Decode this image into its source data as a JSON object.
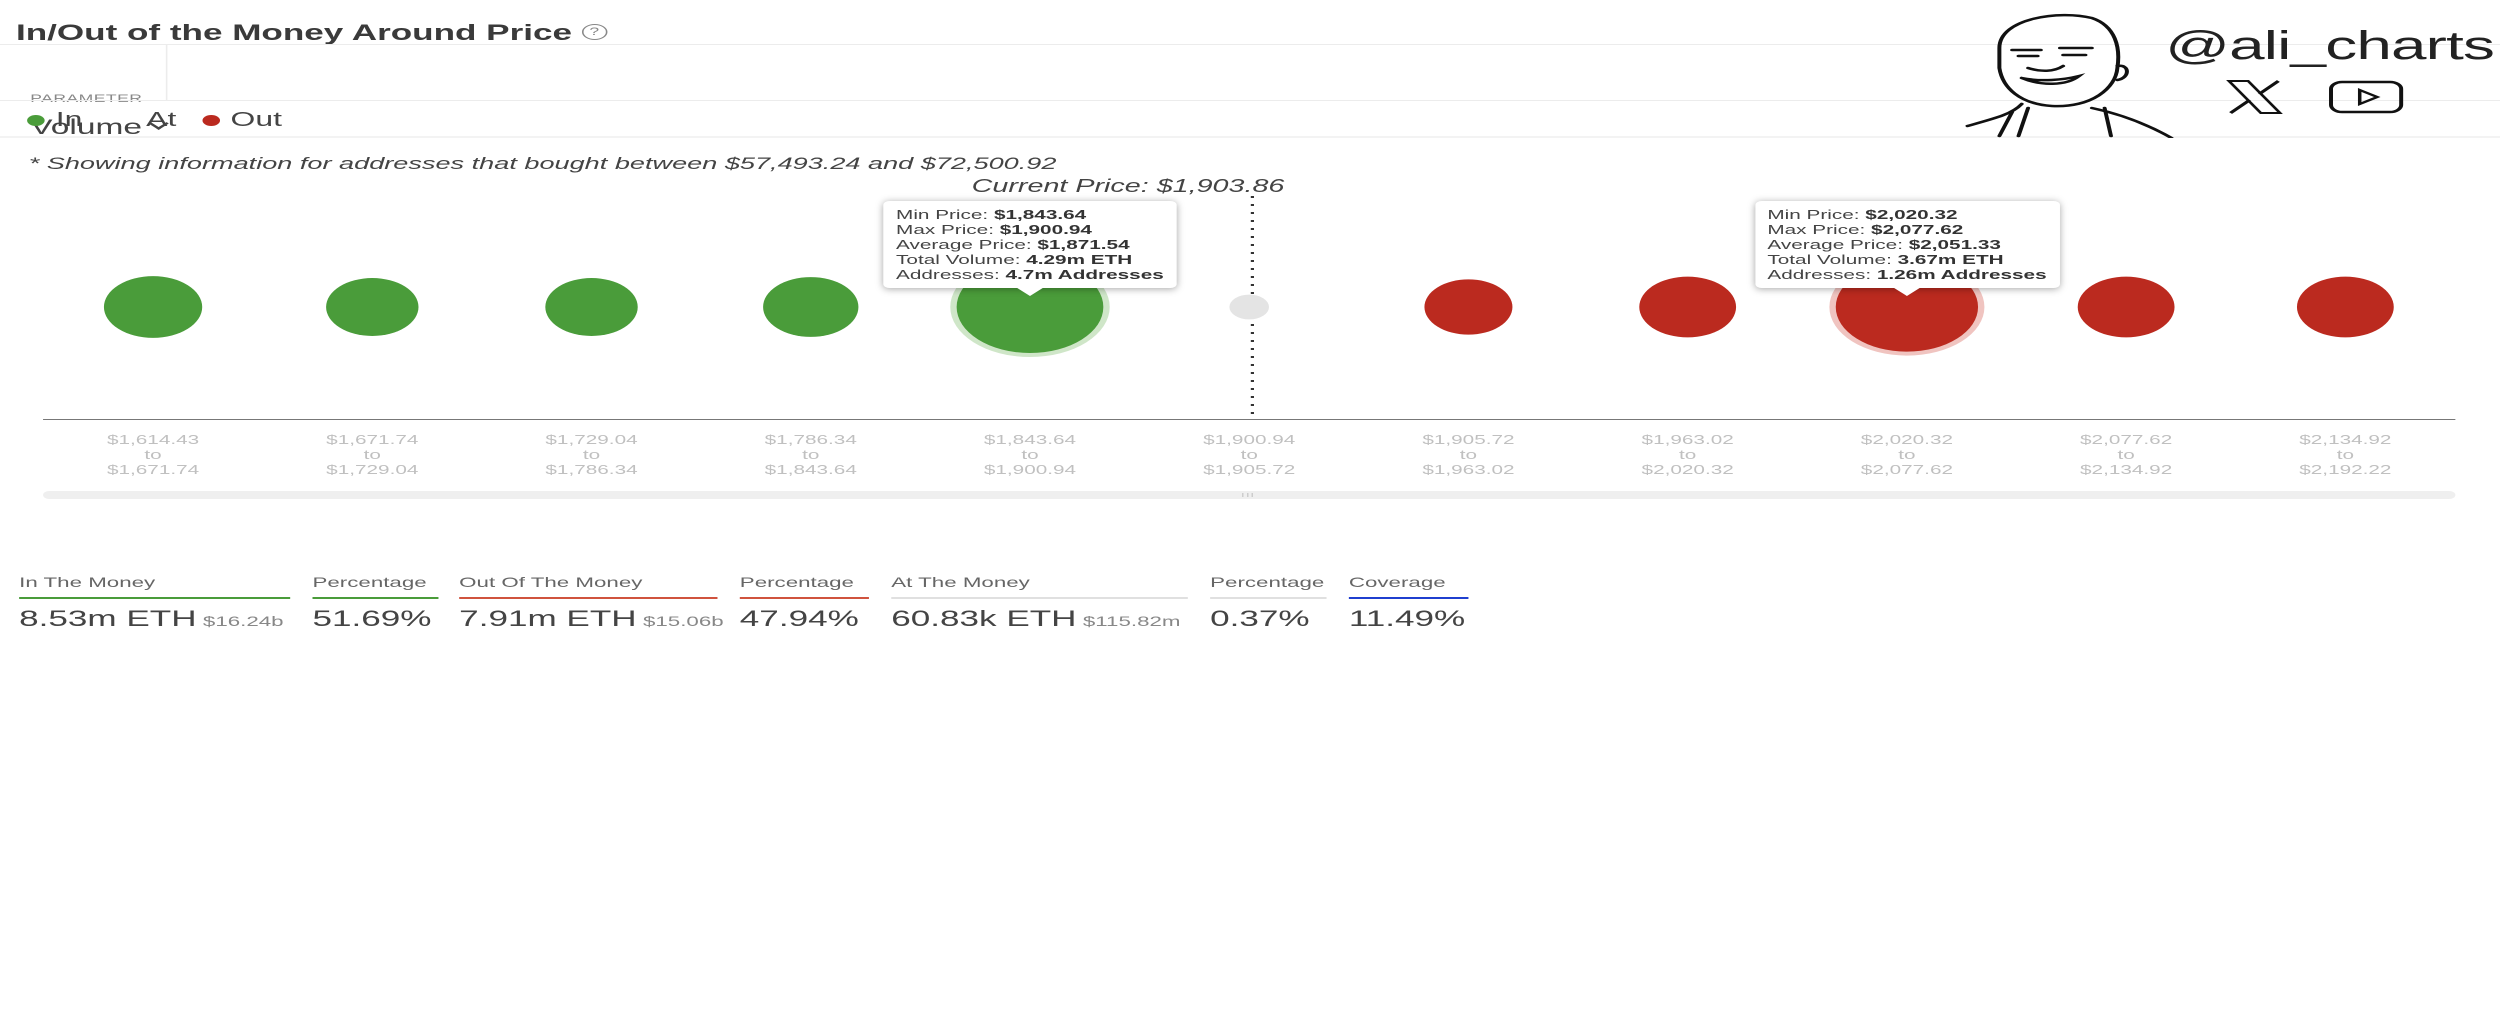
{
  "header": {
    "title": "In/Out of the Money Around Price",
    "help_icon": "?"
  },
  "parameter": {
    "label": "PARAMETER",
    "selected": "Volume"
  },
  "legend": [
    {
      "label": "In",
      "color": "#4a9c3a"
    },
    {
      "label": "At",
      "color": null
    },
    {
      "label": "Out",
      "color": "#bb2a1f"
    }
  ],
  "note": "* Showing information for addresses that bought between $57,493.24 and $72,500.92",
  "current_price_label": "Current Price: $1,903.86",
  "branding": {
    "handle": "@ali_charts",
    "icons": [
      "x-logo-icon",
      "youtube-icon",
      "meme-face-avatar"
    ]
  },
  "colors": {
    "in": "#4a9c3a",
    "out": "#bb2a1f",
    "at": "#e4e4e4",
    "coverage": "#1f3fcf"
  },
  "chart_data": {
    "type": "scatter",
    "title": "In/Out of the Money Around Price",
    "subtitle": "* Showing information for addresses that bought between $57,493.24 and $72,500.92",
    "xlabel": "",
    "ylabel": "",
    "current_price": 1903.86,
    "bubble_size_metric": "Volume",
    "legend": [
      "In",
      "At",
      "Out"
    ],
    "categories": [
      {
        "from": "$1,614.43",
        "to": "$1,671.74",
        "status": "In",
        "relative_size": 0.67
      },
      {
        "from": "$1,671.74",
        "to": "$1,729.04",
        "status": "In",
        "relative_size": 0.63
      },
      {
        "from": "$1,729.04",
        "to": "$1,786.34",
        "status": "In",
        "relative_size": 0.63
      },
      {
        "from": "$1,786.34",
        "to": "$1,843.64",
        "status": "In",
        "relative_size": 0.65
      },
      {
        "from": "$1,843.64",
        "to": "$1,900.94",
        "status": "In",
        "relative_size": 1.0,
        "highlighted": true
      },
      {
        "from": "$1,900.94",
        "to": "$1,905.72",
        "status": "At",
        "relative_size": 0.27
      },
      {
        "from": "$1,905.72",
        "to": "$1,963.02",
        "status": "Out",
        "relative_size": 0.6
      },
      {
        "from": "$1,963.02",
        "to": "$2,020.32",
        "status": "Out",
        "relative_size": 0.66
      },
      {
        "from": "$2,020.32",
        "to": "$2,077.62",
        "status": "Out",
        "relative_size": 0.97,
        "highlighted": true
      },
      {
        "from": "$2,077.62",
        "to": "$2,134.92",
        "status": "Out",
        "relative_size": 0.66
      },
      {
        "from": "$2,134.92",
        "to": "$2,192.22",
        "status": "Out",
        "relative_size": 0.66
      }
    ],
    "range_word": "to",
    "tooltips": [
      {
        "bin_index": 4,
        "rows": [
          {
            "k": "Min Price: ",
            "v": "$1,843.64"
          },
          {
            "k": "Max Price: ",
            "v": "$1,900.94"
          },
          {
            "k": "Average Price: ",
            "v": "$1,871.54"
          },
          {
            "k": "Total Volume: ",
            "v": "4.29m ETH"
          },
          {
            "k": "Addresses: ",
            "v": "4.7m Addresses"
          }
        ]
      },
      {
        "bin_index": 8,
        "rows": [
          {
            "k": "Min Price: ",
            "v": "$2,020.32"
          },
          {
            "k": "Max Price: ",
            "v": "$2,077.62"
          },
          {
            "k": "Average Price: ",
            "v": "$2,051.33"
          },
          {
            "k": "Total Volume: ",
            "v": "3.67m ETH"
          },
          {
            "k": "Addresses: ",
            "v": "1.26m Addresses"
          }
        ]
      }
    ]
  },
  "summary": [
    {
      "label": "In The Money",
      "value": "8.53m ETH",
      "sub": "$16.24b",
      "bar_color": "#4a9c3a"
    },
    {
      "label": "Percentage",
      "value": "51.69%",
      "sub": "",
      "bar_color": "#4a9c3a"
    },
    {
      "label": "Out Of The Money",
      "value": "7.91m ETH",
      "sub": "$15.06b",
      "bar_color": "#d0533e"
    },
    {
      "label": "Percentage",
      "value": "47.94%",
      "sub": "",
      "bar_color": "#d0533e"
    },
    {
      "label": "At The Money",
      "value": "60.83k ETH",
      "sub": "$115.82m",
      "bar_color": "#e0e0e0"
    },
    {
      "label": "Percentage",
      "value": "0.37%",
      "sub": "",
      "bar_color": "#e0e0e0"
    },
    {
      "label": "Coverage",
      "value": "11.49%",
      "sub": "",
      "bar_color": "#1f3fcf"
    }
  ]
}
